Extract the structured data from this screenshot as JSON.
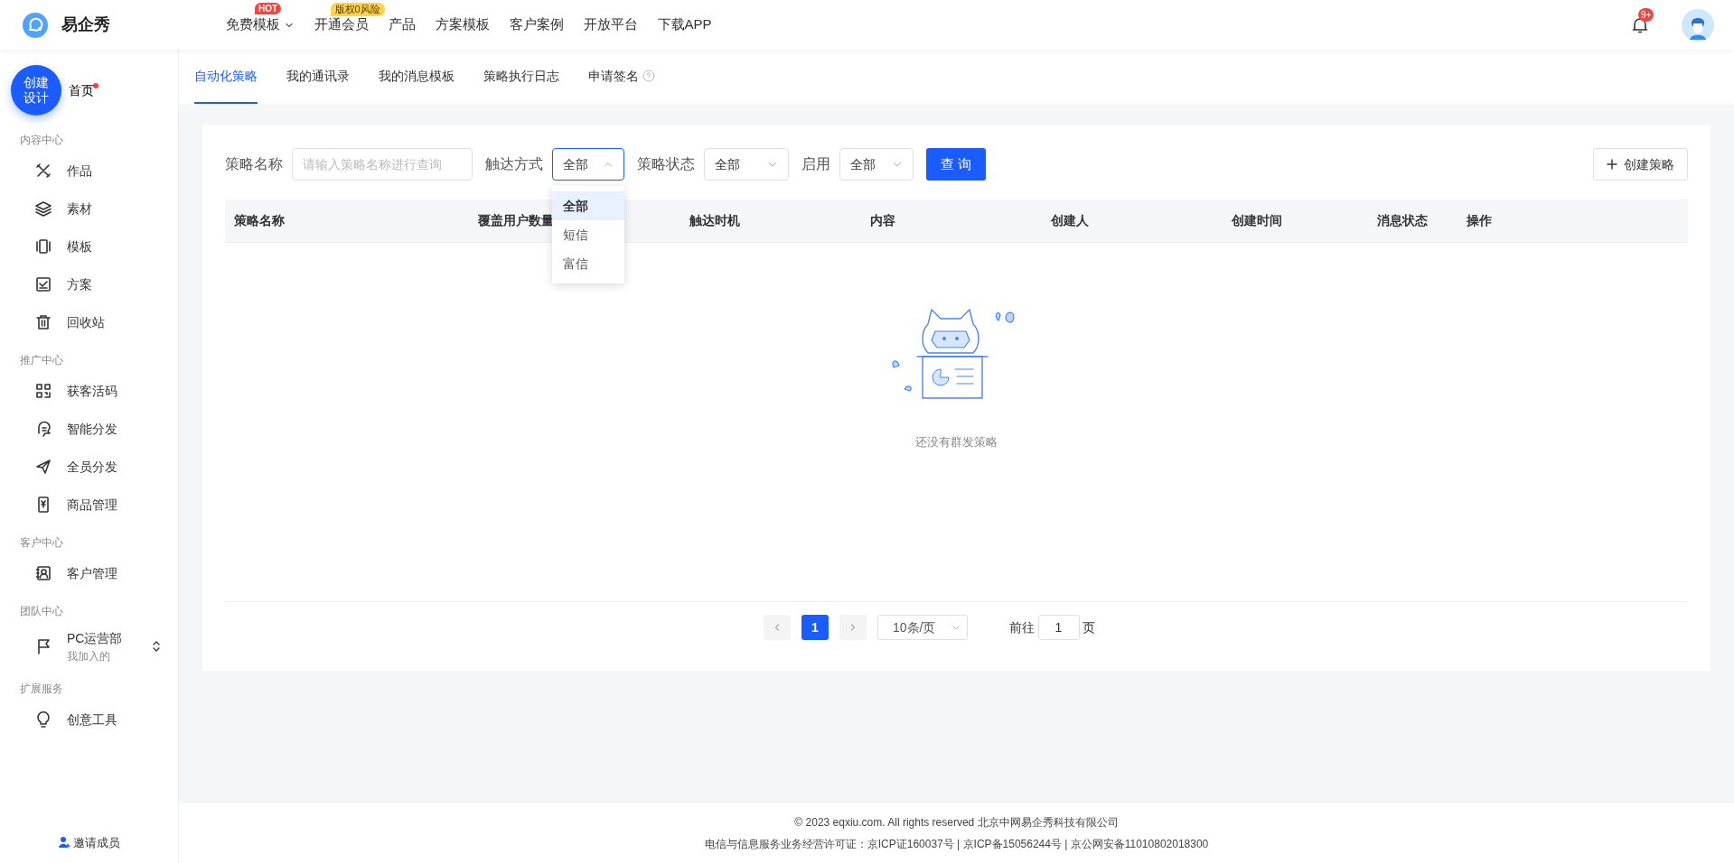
{
  "header": {
    "logo_text": "易企秀",
    "nav": [
      {
        "label": "免费模板",
        "caret": true,
        "badge": {
          "text": "HOT",
          "kind": "hot"
        }
      },
      {
        "label": "开通会员",
        "badge": {
          "text": "版权0风险",
          "kind": "promo"
        }
      },
      {
        "label": "产品"
      },
      {
        "label": "方案模板"
      },
      {
        "label": "客户案例"
      },
      {
        "label": "开放平台"
      },
      {
        "label": "下载APP"
      }
    ],
    "notification_count": "9+"
  },
  "sidebar": {
    "create_button": "创建设计",
    "home": {
      "label": "首页",
      "dot": true
    },
    "sections": [
      {
        "title": "内容中心",
        "items": [
          {
            "label": "作品"
          },
          {
            "label": "素材"
          },
          {
            "label": "模板"
          },
          {
            "label": "方案"
          },
          {
            "label": "回收站"
          }
        ]
      },
      {
        "title": "推广中心",
        "items": [
          {
            "label": "获客活码"
          },
          {
            "label": "智能分发"
          },
          {
            "label": "全员分发"
          },
          {
            "label": "商品管理"
          }
        ]
      },
      {
        "title": "客户中心",
        "items": [
          {
            "label": "客户管理"
          }
        ]
      },
      {
        "title": "团队中心",
        "items": [
          {
            "label": "PC运营部",
            "sublabel": "我加入的"
          }
        ]
      },
      {
        "title": "扩展服务",
        "items": [
          {
            "label": "创意工具"
          }
        ]
      }
    ],
    "invite": "邀请成员"
  },
  "tabs": [
    {
      "label": "自动化策略",
      "selected": true
    },
    {
      "label": "我的通讯录",
      "selected": false
    },
    {
      "label": "我的消息模板",
      "selected": false
    },
    {
      "label": "策略执行日志",
      "selected": false
    },
    {
      "label": "申请签名",
      "selected": false,
      "help": true
    }
  ],
  "filters": {
    "name": {
      "label": "策略名称",
      "placeholder": "请输入策略名称进行查询"
    },
    "selects": [
      {
        "label": "触达方式",
        "value": "全部",
        "open": true,
        "options": [
          {
            "label": "全部",
            "selected": true
          },
          {
            "label": "短信",
            "selected": false
          },
          {
            "label": "富信",
            "selected": false
          }
        ]
      },
      {
        "label": "策略状态",
        "value": "全部",
        "open": false
      },
      {
        "label": "启用",
        "value": "全部",
        "open": false
      }
    ],
    "query_button": "查 询",
    "create_button": "创建策略"
  },
  "table": {
    "columns": [
      "策略名称",
      "覆盖用户数量",
      "触达时机",
      "内容",
      "创建人",
      "创建时间",
      "消息状态",
      "操作"
    ],
    "empty_text": "还没有群发策略"
  },
  "pagination": {
    "pages": [
      {
        "label": "1",
        "selected": true
      }
    ],
    "page_size": "10条/页",
    "goto_label": "前往",
    "goto_value": "1",
    "goto_suffix": "页"
  },
  "footer": [
    "© 2023 eqxiu.com. All rights reserved 北京中网易企秀科技有限公司",
    "电信与信息服务业务经营许可证：京ICP证160037号 | 京ICP备15056244号 | 京公网安备11010802018300"
  ]
}
